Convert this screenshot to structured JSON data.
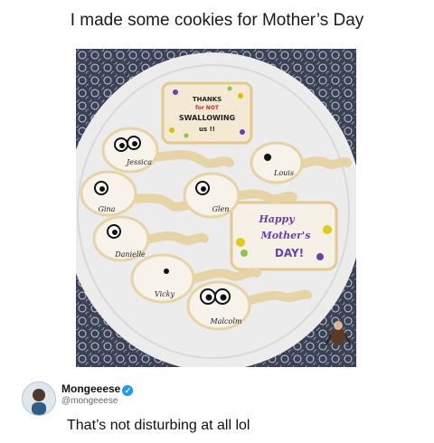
{
  "caption": "I made some cookies for Mother’s Day",
  "photo": {
    "plaque_top": [
      "THANKS",
      "for NOT",
      "SWALLOWING",
      "us !!"
    ],
    "plaque_mid": [
      "Happy",
      "Mother's",
      "DAY!"
    ],
    "cookie_names": [
      "Jessica",
      "Louis",
      "Gina",
      "Glen",
      "Danielle",
      "Vicky",
      "Malcolm"
    ]
  },
  "author": {
    "name": "Mongeeese",
    "handle": "@mongeeese"
  },
  "comment": "That’s not disturbing at all lol",
  "colors": {
    "verified": "#1d9bf0"
  }
}
